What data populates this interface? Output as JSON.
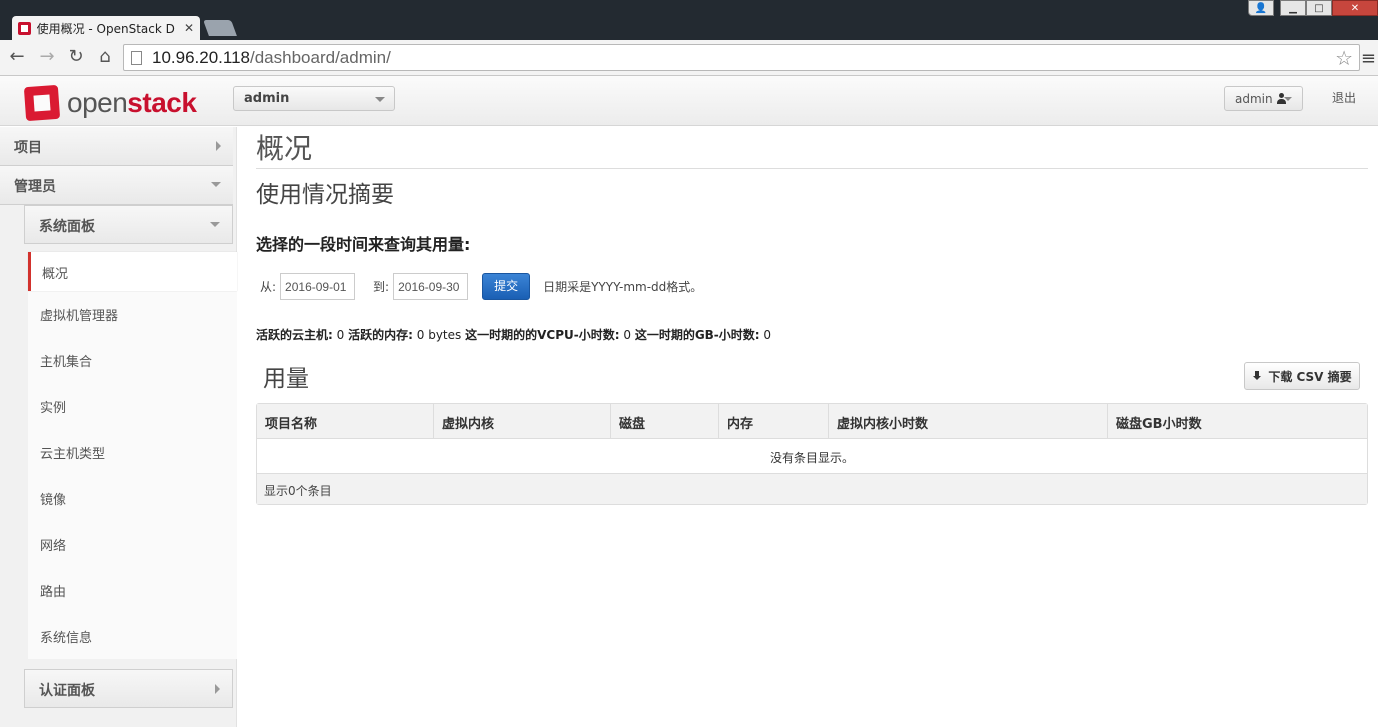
{
  "browser": {
    "tab_title": "使用概况 - OpenStack D",
    "url_host": "10.96.20.118",
    "url_path": "/dashboard/admin/"
  },
  "header": {
    "logo_open": "open",
    "logo_stack": "stack",
    "project_selected": "admin",
    "user_label": "admin",
    "logout_label": "退出"
  },
  "sidebar": {
    "panel_project": "项目",
    "panel_admin": "管理员",
    "sub_system": "系统面板",
    "items": [
      "概况",
      "虚拟机管理器",
      "主机集合",
      "实例",
      "云主机类型",
      "镜像",
      "网络",
      "路由",
      "系统信息"
    ],
    "sub_identity": "认证面板"
  },
  "main": {
    "page_title": "概况",
    "section_title": "使用情况摘要",
    "query_label": "选择的一段时间来查询其用量:",
    "from_label": "从:",
    "from_value": "2016-09-01",
    "to_label": "到:",
    "to_value": "2016-09-30",
    "submit_label": "提交",
    "date_hint": "日期采是YYYY-mm-dd格式。",
    "summary": {
      "active_instances_label": "活跃的云主机:",
      "active_instances": "0",
      "active_memory_label": "活跃的内存:",
      "active_memory": "0 bytes",
      "vcpu_hours_label": "这一时期的的VCPU-小时数:",
      "vcpu_hours": "0",
      "gb_hours_label": "这一时期的GB-小时数:",
      "gb_hours": "0"
    },
    "usage_title": "用量",
    "csv_button": "下载 CSV 摘要",
    "table": {
      "columns": [
        "项目名称",
        "虚拟内核",
        "磁盘",
        "内存",
        "虚拟内核小时数",
        "磁盘GB小时数"
      ],
      "empty_text": "没有条目显示。",
      "footer": "显示0个条目"
    }
  }
}
